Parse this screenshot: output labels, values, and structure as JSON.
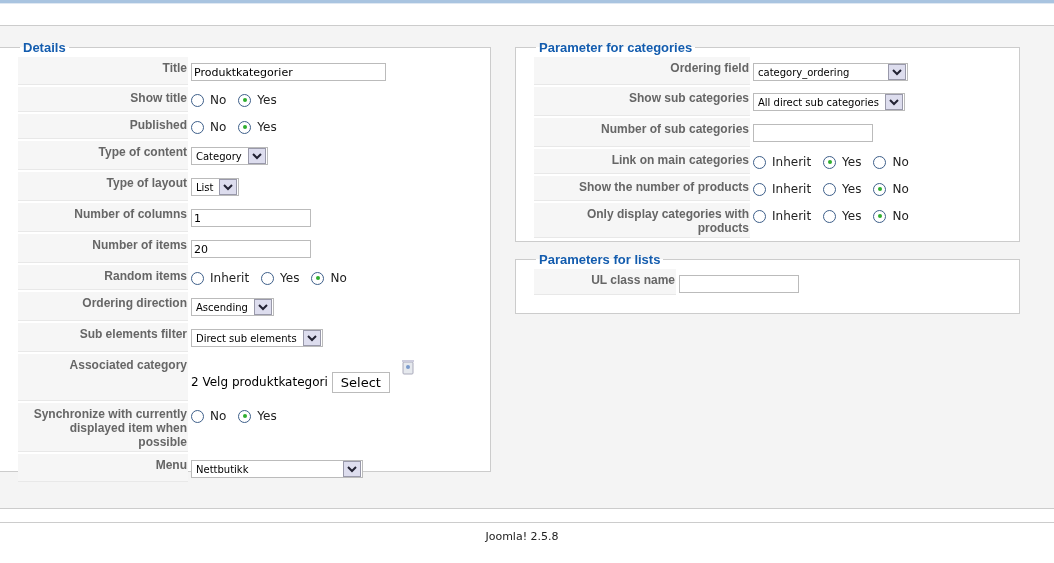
{
  "sections": [
    {
      "legend": "Details",
      "rows": [
        {
          "label": "Title",
          "kind": "text",
          "value": "Produktkategorier"
        },
        {
          "label": "Show title",
          "kind": "radio",
          "options": [
            {
              "label": "No",
              "selected": false
            },
            {
              "label": "Yes",
              "selected": true
            }
          ]
        },
        {
          "label": "Published",
          "kind": "radio",
          "options": [
            {
              "label": "No",
              "selected": false
            },
            {
              "label": "Yes",
              "selected": true
            }
          ]
        },
        {
          "label": "Type of content",
          "kind": "select",
          "value": "Category"
        },
        {
          "label": "Type of layout",
          "kind": "select",
          "value": "List"
        },
        {
          "label": "Number of columns",
          "kind": "text",
          "value": "1"
        },
        {
          "label": "Number of items",
          "kind": "text",
          "value": "20"
        },
        {
          "label": "Random items",
          "kind": "radio",
          "options": [
            {
              "label": "Inherit",
              "selected": false
            },
            {
              "label": "Yes",
              "selected": false
            },
            {
              "label": "No",
              "selected": true
            }
          ]
        },
        {
          "label": "Ordering direction",
          "kind": "select",
          "value": "Ascending"
        },
        {
          "label": "Sub elements filter",
          "kind": "select",
          "value": "Direct sub elements"
        },
        {
          "label": "Associated category",
          "kind": "picker",
          "value": "2 Velg produktkategori",
          "button": "Select"
        },
        {
          "label": "Synchronize with currently displayed item when possible",
          "kind": "radio",
          "options": [
            {
              "label": "No",
              "selected": false
            },
            {
              "label": "Yes",
              "selected": true
            }
          ]
        },
        {
          "label": "Menu",
          "kind": "select",
          "value": "Nettbutikk"
        }
      ]
    },
    {
      "legend": "Parameter for categories",
      "rows": [
        {
          "label": "Ordering field",
          "kind": "select",
          "value": "category_ordering"
        },
        {
          "label": "Show sub categories",
          "kind": "select",
          "value": "All direct sub categories"
        },
        {
          "label": "Number of sub categories",
          "kind": "text"
        },
        {
          "label": "Link on main categories",
          "kind": "radio",
          "options": [
            {
              "label": "Inherit",
              "selected": false
            },
            {
              "label": "Yes",
              "selected": true
            },
            {
              "label": "No",
              "selected": false
            }
          ]
        },
        {
          "label": "Show the number of products",
          "kind": "radio",
          "options": [
            {
              "label": "Inherit",
              "selected": false
            },
            {
              "label": "Yes",
              "selected": false
            },
            {
              "label": "No",
              "selected": true
            }
          ]
        },
        {
          "label": "Only display categories with products",
          "kind": "radio",
          "options": [
            {
              "label": "Inherit",
              "selected": false
            },
            {
              "label": "Yes",
              "selected": false
            },
            {
              "label": "No",
              "selected": true
            }
          ]
        }
      ]
    },
    {
      "legend": "Parameters for lists",
      "rows": [
        {
          "label": "UL class name",
          "kind": "text"
        }
      ]
    }
  ],
  "footer": "Joomla! 2.5.8"
}
